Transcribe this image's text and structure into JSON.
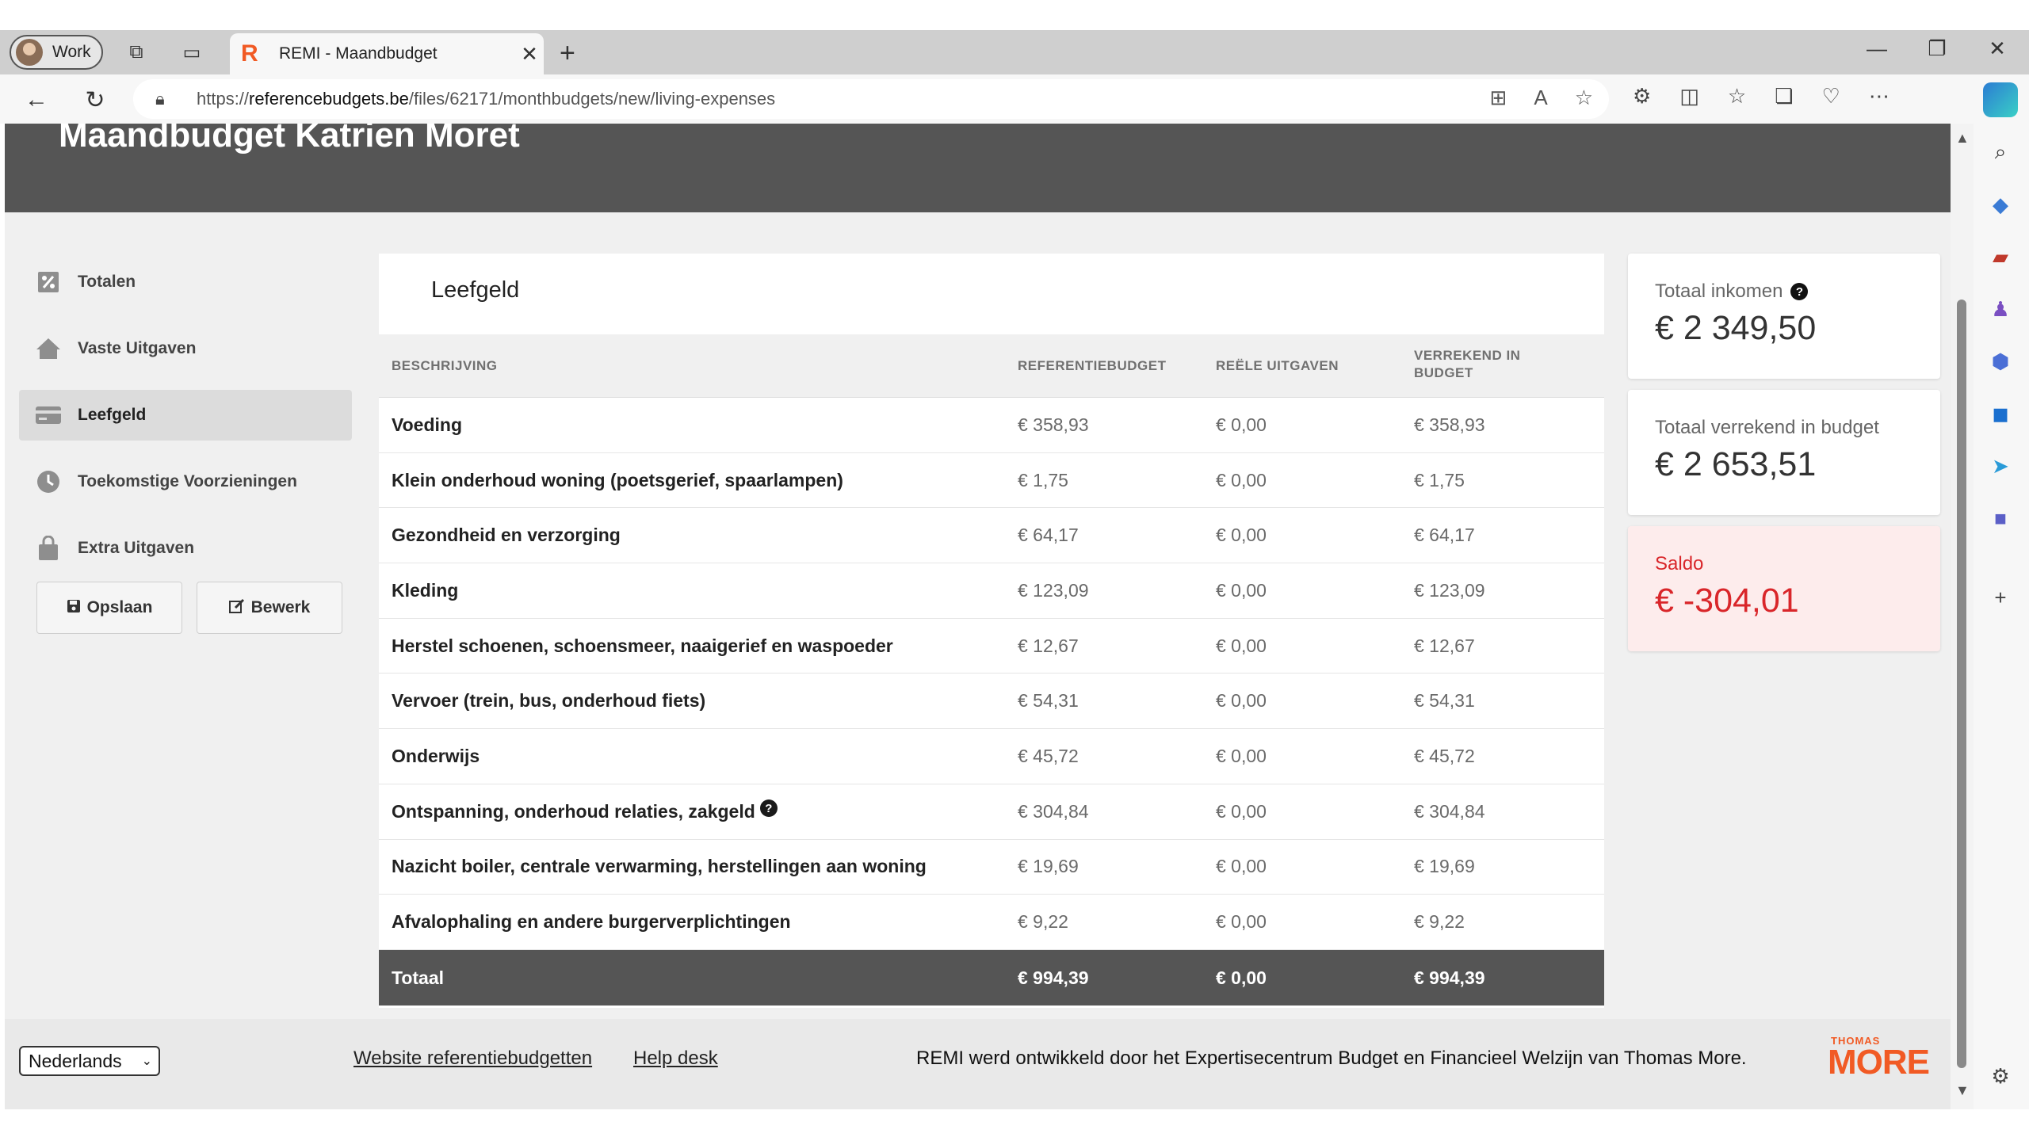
{
  "browser": {
    "profile_label": "Work",
    "tab_title": "REMI - Maandbudget",
    "tab_favicon": "R",
    "url_prefix": "https://",
    "url_host": "referencebudgets.be",
    "url_path": "/files/62171/monthbudgets/new/living-expenses"
  },
  "page": {
    "title": "Maandbudget Katrien Moret"
  },
  "sidebar": {
    "items": [
      {
        "label": "Totalen",
        "icon": "percent-doc-icon"
      },
      {
        "label": "Vaste Uitgaven",
        "icon": "home-icon"
      },
      {
        "label": "Leefgeld",
        "icon": "credit-card-icon"
      },
      {
        "label": "Toekomstige Voorzieningen",
        "icon": "clock-icon"
      },
      {
        "label": "Extra Uitgaven",
        "icon": "shopping-bag-icon"
      }
    ],
    "active_index": 2,
    "save_label": "Opslaan",
    "edit_label": "Bewerk"
  },
  "card": {
    "title": "Leefgeld",
    "columns": {
      "description": "BESCHRIJVING",
      "reference": "REFERENTIEBUDGET",
      "real": "REËLE UITGAVEN",
      "accounted_line1": "VERREKEND IN",
      "accounted_line2": "BUDGET"
    },
    "rows": [
      {
        "desc": "Voeding",
        "ref": "€ 358,93",
        "real": "€ 0,00",
        "acc": "€ 358,93"
      },
      {
        "desc": "Klein onderhoud woning (poetsgerief, spaarlampen)",
        "ref": "€ 1,75",
        "real": "€ 0,00",
        "acc": "€ 1,75"
      },
      {
        "desc": "Gezondheid en verzorging",
        "ref": "€ 64,17",
        "real": "€ 0,00",
        "acc": "€ 64,17"
      },
      {
        "desc": "Kleding",
        "ref": "€ 123,09",
        "real": "€ 0,00",
        "acc": "€ 123,09"
      },
      {
        "desc": "Herstel schoenen, schoensmeer, naaigerief en waspoeder",
        "ref": "€ 12,67",
        "real": "€ 0,00",
        "acc": "€ 12,67"
      },
      {
        "desc": "Vervoer (trein, bus, onderhoud fiets)",
        "ref": "€ 54,31",
        "real": "€ 0,00",
        "acc": "€ 54,31"
      },
      {
        "desc": "Onderwijs",
        "ref": "€ 45,72",
        "real": "€ 0,00",
        "acc": "€ 45,72"
      },
      {
        "desc": "Ontspanning, onderhoud relaties, zakgeld",
        "ref": "€ 304,84",
        "real": "€ 0,00",
        "acc": "€ 304,84",
        "help": "?"
      },
      {
        "desc": "Nazicht boiler, centrale verwarming, herstellingen aan woning",
        "ref": "€ 19,69",
        "real": "€ 0,00",
        "acc": "€ 19,69"
      },
      {
        "desc": "Afvalophaling en andere burgerverplichtingen",
        "ref": "€ 9,22",
        "real": "€ 0,00",
        "acc": "€ 9,22"
      }
    ],
    "total": {
      "desc": "Totaal",
      "ref": "€ 994,39",
      "real": "€ 0,00",
      "acc": "€ 994,39"
    }
  },
  "summary": {
    "income_label": "Totaal inkomen",
    "income_value": "€ 2 349,50",
    "income_help": "?",
    "budget_label": "Totaal verrekend in budget",
    "budget_value": "€ 2 653,51",
    "saldo_label": "Saldo",
    "saldo_value": "€ -304,01",
    "saldo_color": "#d9262a"
  },
  "footer": {
    "language": "Nederlands",
    "link_website": "Website referentiebudgetten",
    "link_help": "Help desk",
    "credit": "REMI werd ontwikkeld door het Expertisecentrum Budget en Financieel Welzijn van Thomas More.",
    "logo_small": "THOMAS",
    "logo_big": "MORE",
    "brand_color": "#f15a24"
  }
}
